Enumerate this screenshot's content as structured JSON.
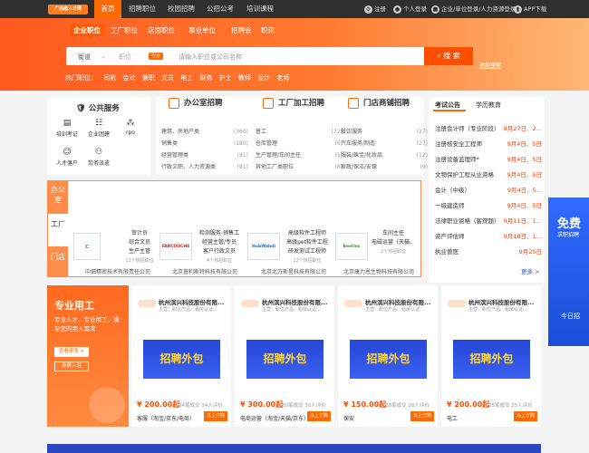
{
  "topnav": {
    "logo": "广西南人才网",
    "items": [
      {
        "label": "首页",
        "active": true
      },
      {
        "label": "招聘职位"
      },
      {
        "label": "校园招聘"
      },
      {
        "label": "公招公考"
      },
      {
        "label": "培训课程"
      }
    ],
    "right": {
      "register": "注册",
      "personal_login": "个人登录",
      "company_login": "企业/单位登录/人力资源登录",
      "app": "APP下载"
    }
  },
  "search": {
    "tabs": [
      "企业职位",
      "工厂职位",
      "店面职位",
      "事业单位",
      "招聘会",
      "职讯"
    ],
    "location": "街道",
    "category": "行业",
    "tag": "职位",
    "placeholder": "请输入职位或公司名称",
    "button": "搜 索",
    "advanced": "高级搜索",
    "hot_label": "热门职位：",
    "hot": [
      "司机",
      "会计",
      "兼职",
      "文员",
      "电工",
      "财务",
      "护士",
      "教师",
      "设计",
      "老师"
    ]
  },
  "services": {
    "title": "公共服务",
    "items": [
      {
        "label": "培训考证",
        "icon": "book-icon"
      },
      {
        "label": "企业团建",
        "icon": "team-icon"
      },
      {
        "label": "rpo",
        "icon": "rpo-icon"
      },
      {
        "label": "人才落户",
        "icon": "person-icon"
      },
      {
        "label": "劳务派遣",
        "icon": "handshake-icon"
      }
    ]
  },
  "office": {
    "title": "办公室招聘",
    "rows": [
      [
        "建筑、房地产类",
        "(360)"
      ],
      [
        "销售类",
        "(180)"
      ],
      [
        "经营管理类",
        "(81)"
      ],
      [
        "行政文职、人力资源类",
        "(81)"
      ]
    ]
  },
  "factory": {
    "title": "工厂加工招聘",
    "rows": [
      [
        "普工",
        "(72)"
      ],
      [
        "仓库管理",
        "(6)"
      ],
      [
        "生产管理/车间主任",
        "(5)"
      ],
      [
        "其他工厂类职位",
        "(8)"
      ]
    ]
  },
  "store": {
    "title": "门店商铺招聘",
    "rows": [
      [
        "餐饮服务",
        "(27)"
      ],
      [
        "汽车服务/制造",
        "(27)"
      ],
      [
        "服装/珠宝/化妆品",
        "(12)"
      ],
      [
        "家政/保洁/安保",
        "(9)"
      ]
    ]
  },
  "notice": {
    "tabs": [
      "考试公告",
      "学历教育"
    ],
    "rows": [
      [
        "注册会计师（专业阶段）",
        "8月27日、2..."
      ],
      [
        "注册核安全工程师",
        "9月4日、5日"
      ],
      [
        "注册设备监理师*",
        "9月4日、5日"
      ],
      [
        "文物保护工程从业资格",
        "9月4日、5日"
      ],
      [
        "会计（中级）",
        "9月4日、5..."
      ],
      [
        "一级建造师",
        "9月4日、5日"
      ],
      [
        "法律职业资格（客观题）",
        "9月11日、1..."
      ],
      [
        "资产评估师",
        "9月18日、1..."
      ],
      [
        "执业兽医",
        "9月25日"
      ]
    ],
    "more": "更多 >"
  },
  "factory_tabs": [
    "办公室",
    "工厂",
    "门店"
  ],
  "companies": [
    {
      "logo": "C",
      "desc1": "审计员",
      "desc2": "综合文员",
      "desc3": "生产主管",
      "count": "11个热招职位",
      "name": "中细精密技术有限责任公司"
    },
    {
      "logo": "FARCOOCHE",
      "desc1": "检测服务-销售工",
      "desc2": "经营主管/专员",
      "desc3": "客户行政文员",
      "count": "4个热招职位",
      "name": "北京普利斯特科技有限公司"
    },
    {
      "logo": "HubWahdi",
      "desc1": "高级软件工程师",
      "desc2": "高级pet软件工程",
      "desc3": "研发测试工程师",
      "count": "12个热招职位",
      "name": "北京北方斯星科技有限公司"
    },
    {
      "logo": "Beetles",
      "desc1": "车间主任",
      "desc2": "电磁运营（天猫、",
      "desc3": "",
      "count": "2个热招职位",
      "name": "北京康力恩生物科技有限公司"
    }
  ],
  "outsourcing": {
    "title": "专业用工",
    "desc": "专业人才，专业用工，满足您的用人需求",
    "btn1": "查看更多 >",
    "btn2": "免费入驻"
  },
  "products": [
    {
      "name": "杭州滨兴科技股份有限...",
      "sub": "主营：职位产品、租房认证...",
      "banner": "招聘外包",
      "price": "¥ 200.00起",
      "sold": "34笔成交",
      "reviews": "34人评价",
      "title": "客服（淘宝/京东/电商）",
      "buy": "马上订购"
    },
    {
      "name": "杭州滨兴科技股份有限...",
      "sub": "主营：职位产品、租房认证...",
      "banner": "招聘外包",
      "price": "¥ 300.00起",
      "sold": "30笔成交",
      "reviews": "30人评价",
      "title": "电商运营（淘宝/天猫/京东）",
      "buy": "马上订购"
    },
    {
      "name": "杭州滨兴科技股份有限...",
      "sub": "主营：职位产品、租房认证...",
      "banner": "招聘外包",
      "price": "¥ 150.00起",
      "sold": "28笔成交",
      "reviews": "28人评价",
      "title": "保安",
      "buy": "马上订购"
    },
    {
      "name": "杭州滨兴科技股份有限...",
      "sub": "主营：职位产品、租房认证...",
      "banner": "招聘外包",
      "price": "¥ 200.00起",
      "sold": "25笔成交",
      "reviews": "25人评价",
      "title": "电工",
      "buy": "马上订购"
    }
  ],
  "side_banner": {
    "title": "免费",
    "sub": "求职招聘",
    "foot": "今日招"
  },
  "colors": {
    "accent": "#ff6a00",
    "nav": "#2f2f2f"
  }
}
